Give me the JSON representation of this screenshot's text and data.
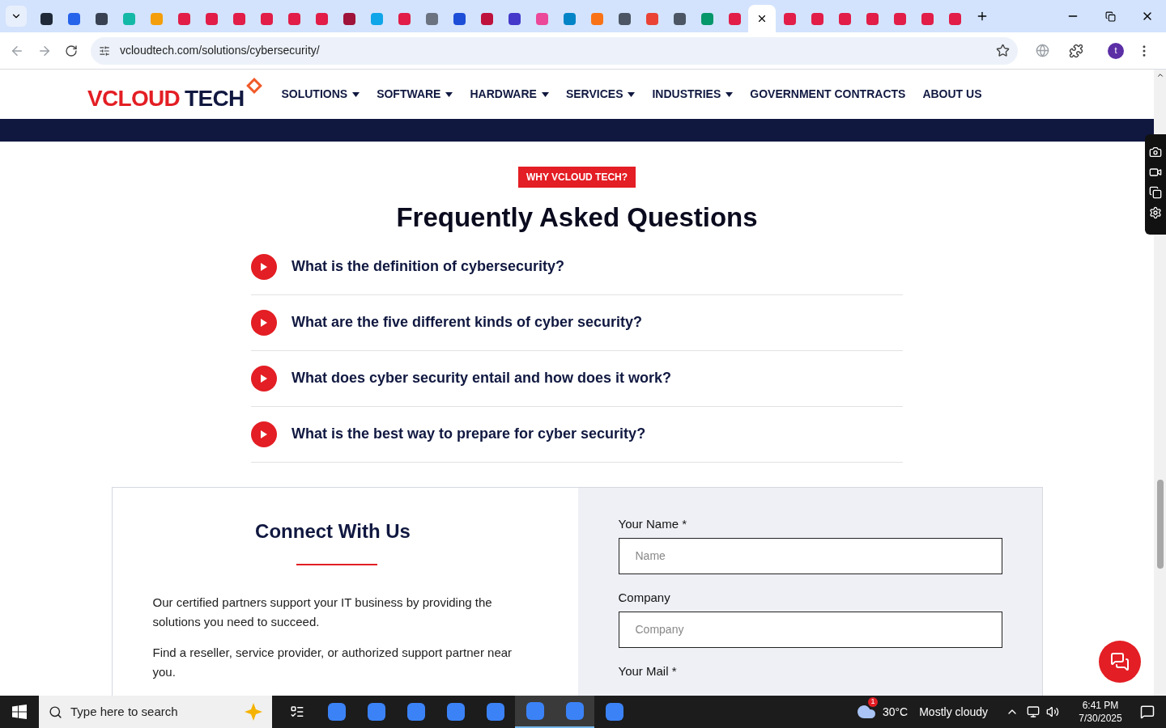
{
  "browser": {
    "tabs": [
      {
        "color": "#1f2937",
        "selected": false
      },
      {
        "color": "#2563eb",
        "selected": false
      },
      {
        "color": "#374151",
        "selected": false
      },
      {
        "color": "#14b8a6",
        "selected": false
      },
      {
        "color": "#f59e0b",
        "selected": false
      },
      {
        "color": "#e11d48",
        "selected": false
      },
      {
        "color": "#e11d48",
        "selected": false
      },
      {
        "color": "#e11d48",
        "selected": false
      },
      {
        "color": "#e11d48",
        "selected": false
      },
      {
        "color": "#e11d48",
        "selected": false
      },
      {
        "color": "#e11d48",
        "selected": false
      },
      {
        "color": "#9f1239",
        "selected": false
      },
      {
        "color": "#0ea5e9",
        "selected": false
      },
      {
        "color": "#e11d48",
        "selected": false
      },
      {
        "color": "#6b7280",
        "selected": false
      },
      {
        "color": "#1d4ed8",
        "selected": false
      },
      {
        "color": "#be123c",
        "selected": false
      },
      {
        "color": "#4338ca",
        "selected": false
      },
      {
        "color": "#ec4899",
        "selected": false
      },
      {
        "color": "#0284c7",
        "selected": false
      },
      {
        "color": "#f97316",
        "selected": false
      },
      {
        "color": "#4b5563",
        "selected": false
      },
      {
        "color": "#ea4335",
        "selected": false
      },
      {
        "color": "#4b5563",
        "selected": false
      },
      {
        "color": "#059669",
        "selected": false
      },
      {
        "color": "#e11d48",
        "selected": false
      },
      {
        "selected": true
      },
      {
        "color": "#e11d48",
        "selected": false
      },
      {
        "color": "#e11d48",
        "selected": false
      },
      {
        "color": "#e11d48",
        "selected": false
      },
      {
        "color": "#e11d48",
        "selected": false
      },
      {
        "color": "#e11d48",
        "selected": false
      },
      {
        "color": "#e11d48",
        "selected": false
      },
      {
        "color": "#e11d48",
        "selected": false
      }
    ],
    "url": "vcloudtech.com/solutions/cybersecurity/",
    "profile_initial": "t"
  },
  "site": {
    "logo": {
      "main": "VCLOUD",
      "second": "TECH"
    },
    "nav": [
      {
        "label": "SOLUTIONS",
        "dropdown": true
      },
      {
        "label": "SOFTWARE",
        "dropdown": true
      },
      {
        "label": "HARDWARE",
        "dropdown": true
      },
      {
        "label": "SERVICES",
        "dropdown": true
      },
      {
        "label": "INDUSTRIES",
        "dropdown": true
      },
      {
        "label": "GOVERNMENT CONTRACTS",
        "dropdown": false
      },
      {
        "label": "ABOUT US",
        "dropdown": false
      }
    ]
  },
  "faq": {
    "badge": "WHY VCLOUD TECH?",
    "title": "Frequently Asked Questions",
    "items": [
      {
        "question": "What is the definition of cybersecurity?",
        "expanded": false
      },
      {
        "question": "What are the five different kinds of cyber security?",
        "expanded": false
      },
      {
        "question": "What does cyber security entail and how does it work?",
        "expanded": false
      },
      {
        "question": "What is the best way to prepare for cyber security?",
        "expanded": false
      }
    ]
  },
  "connect": {
    "title": "Connect With Us",
    "paragraphs": [
      "Our certified partners support your IT business by providing the solutions you need to succeed.",
      "Find a reseller, service provider, or authorized support partner near you."
    ],
    "fields": [
      {
        "label": "Your Name *",
        "placeholder": "Name"
      },
      {
        "label": "Company",
        "placeholder": "Company"
      },
      {
        "label": "Your Mail *"
      }
    ]
  },
  "taskbar": {
    "search_placeholder": "Type here to search",
    "apps": [
      {
        "selected": false
      },
      {
        "selected": false
      },
      {
        "selected": false
      },
      {
        "selected": false
      },
      {
        "selected": false
      },
      {
        "selected": false
      },
      {
        "selected": true
      },
      {
        "selected": true
      },
      {
        "selected": false
      }
    ],
    "weather": {
      "badge": "1",
      "temperature": "30°C",
      "condition": "Mostly cloudy"
    },
    "time": "6:41 PM",
    "date": "7/30/2025"
  }
}
